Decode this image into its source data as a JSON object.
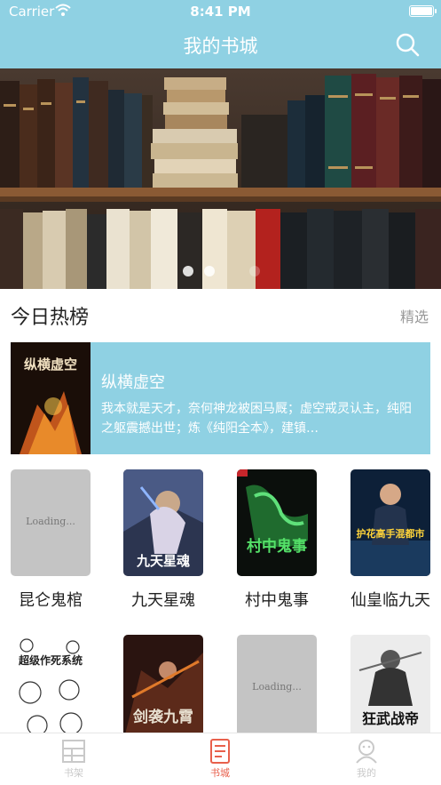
{
  "status_bar": {
    "carrier": "Carrier",
    "time": "8:41 PM"
  },
  "header": {
    "title": "我的书城",
    "accent_color": "#8fd1e3",
    "search_icon": "search-icon"
  },
  "banner": {
    "slide_count": 3,
    "active_slide": 3
  },
  "hot_section": {
    "title": "今日热榜",
    "more_label": "精选"
  },
  "featured": {
    "title": "纵横虚空",
    "description": "我本就是天才，奈何神龙被困马厩；虚空戒灵认主，纯阳之躯震撼出世；炼《纯阳全本》，建镇…",
    "cover_text": "纵横虚空"
  },
  "books": [
    {
      "title": "昆仑鬼棺",
      "cover": "loading",
      "loading_text": "Loading..."
    },
    {
      "title": "九天星魂",
      "cover": "image",
      "cover_text": "九天星魂"
    },
    {
      "title": "村中鬼事",
      "cover": "image",
      "cover_text": "村中鬼事"
    },
    {
      "title": "仙皇临九天",
      "cover": "image",
      "cover_text": "护花高手混都市"
    },
    {
      "title": "",
      "cover": "image",
      "cover_text": "超级作死系统"
    },
    {
      "title": "",
      "cover": "image",
      "cover_text": "剑袭九霄"
    },
    {
      "title": "",
      "cover": "loading",
      "loading_text": "Loading..."
    },
    {
      "title": "",
      "cover": "image",
      "cover_text": "狂武战帝"
    }
  ],
  "tabbar": {
    "items": [
      {
        "label": "书架",
        "icon": "bookshelf-icon",
        "active": false
      },
      {
        "label": "书城",
        "icon": "bookstore-icon",
        "active": true
      },
      {
        "label": "我的",
        "icon": "profile-icon",
        "active": false
      }
    ],
    "active_color": "#e8604c",
    "inactive_color": "#c9c9c9"
  }
}
